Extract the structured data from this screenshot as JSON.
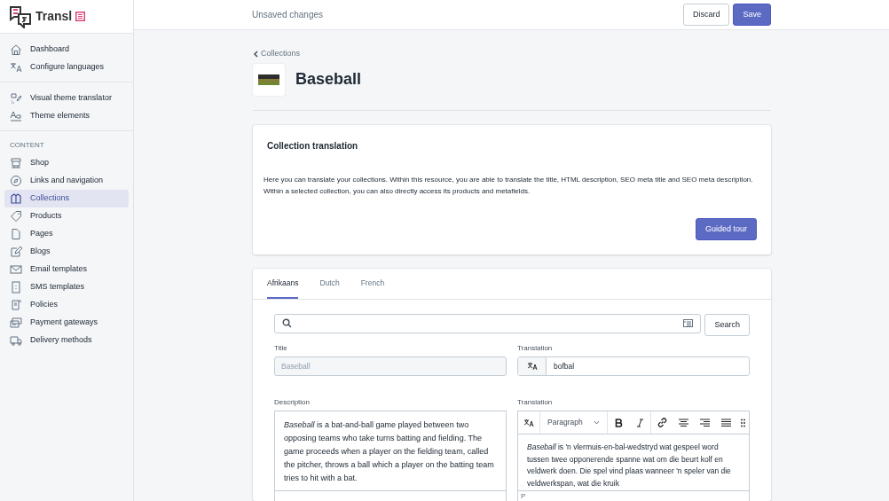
{
  "brand": {
    "name": "Transl"
  },
  "topbar": {
    "status": "Unsaved changes",
    "buttons": [
      {
        "label": "Discard",
        "kind": "secondary"
      },
      {
        "label": "Save",
        "kind": "primary"
      }
    ]
  },
  "sidebar": {
    "groups": [
      {
        "items": [
          {
            "label": "Dashboard",
            "selected": false
          },
          {
            "label": "Configure languages",
            "selected": false
          }
        ]
      },
      {
        "items": [
          {
            "label": "Visual theme translator",
            "selected": false
          },
          {
            "label": "Theme elements",
            "selected": false
          }
        ]
      },
      {
        "heading": "CONTENT",
        "items": [
          {
            "label": "Shop",
            "selected": false
          },
          {
            "label": "Links and navigation",
            "selected": false
          },
          {
            "label": "Collections",
            "selected": true
          },
          {
            "label": "Products",
            "selected": false
          },
          {
            "label": "Pages",
            "selected": false
          },
          {
            "label": "Blogs",
            "selected": false
          },
          {
            "label": "Email templates",
            "selected": false
          },
          {
            "label": "SMS templates",
            "selected": false
          },
          {
            "label": "Policies",
            "selected": false
          },
          {
            "label": "Payment gateways",
            "selected": false
          },
          {
            "label": "Delivery methods",
            "selected": false
          }
        ]
      }
    ]
  },
  "breadcrumb": "Collections",
  "page_title": "Baseball",
  "intro_card": {
    "title": "Collection translation",
    "text": "Here you can translate your collections. Within this resource, you are able to translate the title, HTML description, SEO meta title and SEO meta description. Within a selected collection, you can also directly access its products and metafields.",
    "button": "Guided tour"
  },
  "tabs": [
    {
      "label": "Afrikaans",
      "selected": true
    },
    {
      "label": "Dutch",
      "selected": false
    },
    {
      "label": "French",
      "selected": false
    }
  ],
  "search": {
    "button": "Search"
  },
  "title_field": {
    "label": "Title",
    "value": "Baseball"
  },
  "title_translation": {
    "label": "Translation",
    "value": "bofbal"
  },
  "description": {
    "label": "Description",
    "text": "*Baseball* is a bat-and-ball game played between two opposing teams who take turns batting and fielding. The game proceeds when a player on the fielding team, called the pitcher, throws a ball which a player on the batting team tries to hit with a bat."
  },
  "description_translation": {
    "label": "Translation",
    "format": "Paragraph",
    "text": "*Baseball* is 'n vlermuis-en-bal-wedstryd wat gespeel word tussen twee opponerende spanne wat om die beurt kolf en veldwerk doen. Die spel vind plaas wanneer 'n speler van die veldwerkspan, wat die kruik",
    "path": "P"
  }
}
